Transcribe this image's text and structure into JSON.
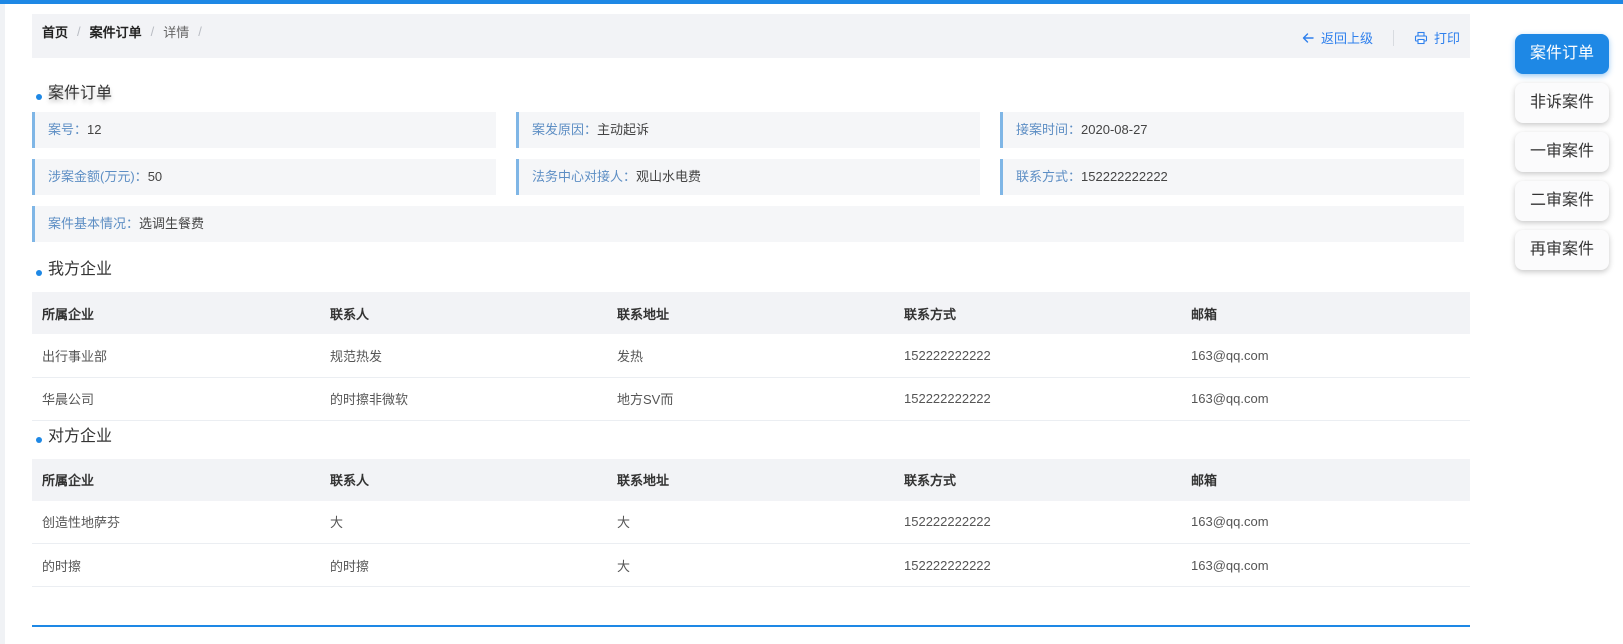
{
  "breadcrumb": {
    "home": "首页",
    "orders": "案件订单",
    "detail": "详情",
    "sep": "/"
  },
  "actions": {
    "back": "返回上级",
    "print": "打印"
  },
  "sections": {
    "order": "案件订单",
    "our_company": "我方企业",
    "other_company": "对方企业"
  },
  "info": [
    {
      "label": "案号",
      "value": "12"
    },
    {
      "label": "案发原因",
      "value": "主动起诉"
    },
    {
      "label": "接案时间",
      "value": "2020-08-27"
    },
    {
      "label": "涉案金额(万元)",
      "value": "50"
    },
    {
      "label": "法务中心对接人",
      "value": "观山水电费"
    },
    {
      "label": "联系方式",
      "value": "152222222222"
    },
    {
      "label": "案件基本情况",
      "value": "选调生餐费"
    }
  ],
  "info_sep": "：",
  "table_headers": [
    "所属企业",
    "联系人",
    "联系地址",
    "联系方式",
    "邮箱"
  ],
  "our_rows": [
    [
      "出行事业部",
      "规范热发",
      "发热",
      "152222222222",
      "163@qq.com"
    ],
    [
      "华晨公司",
      "的时擦非微软",
      "地方SV而",
      "152222222222",
      "163@qq.com"
    ]
  ],
  "other_rows": [
    [
      "创造性地萨芬",
      "大",
      "大",
      "152222222222",
      "163@qq.com"
    ],
    [
      "的时擦",
      "的时擦",
      "大",
      "152222222222",
      "163@qq.com"
    ]
  ],
  "side_nav": [
    {
      "label": "案件订单",
      "active": true
    },
    {
      "label": "非诉案件",
      "active": false
    },
    {
      "label": "一审案件",
      "active": false
    },
    {
      "label": "二审案件",
      "active": false
    },
    {
      "label": "再审案件",
      "active": false
    }
  ],
  "colors": {
    "accent": "#1e88e5",
    "link": "#2f80ed",
    "label": "#5d8ec4"
  }
}
